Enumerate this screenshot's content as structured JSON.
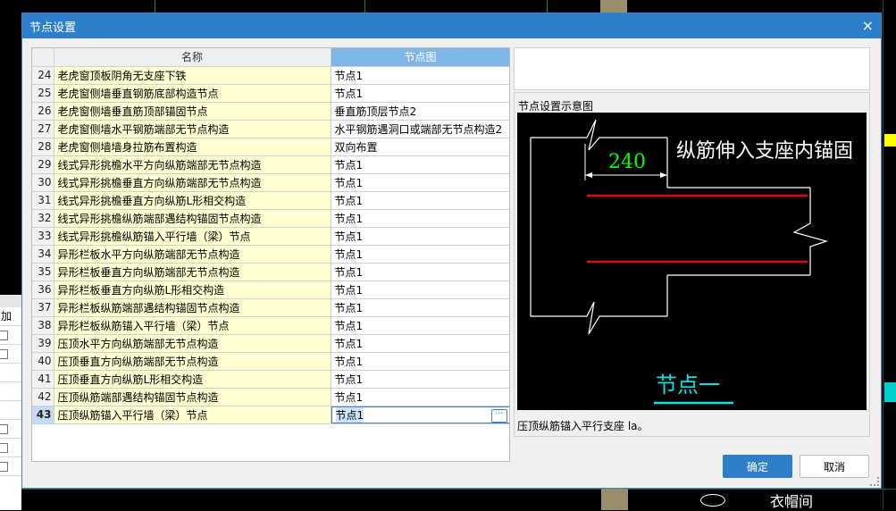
{
  "dialog": {
    "title": "节点设置",
    "close_glyph": "×",
    "ok_label": "确定",
    "cancel_label": "取消"
  },
  "grid": {
    "headers": [
      "",
      "名称",
      "节点图"
    ],
    "rows": [
      {
        "num": "24",
        "name": "老虎窗顶板阴角无支座下铁",
        "value": "节点1"
      },
      {
        "num": "25",
        "name": "老虎窗侧墙垂直钢筋底部构造节点",
        "value": "节点1"
      },
      {
        "num": "26",
        "name": "老虎窗侧墙垂直筋顶部锚固节点",
        "value": "垂直筋顶层节点2"
      },
      {
        "num": "27",
        "name": "老虎窗侧墙水平钢筋端部无节点构造",
        "value": "水平钢筋遇洞口或端部无节点构造2"
      },
      {
        "num": "28",
        "name": "老虎窗侧墙墙身拉筋布置构造",
        "value": "双向布置"
      },
      {
        "num": "29",
        "name": "线式异形挑檐水平方向纵筋端部无节点构造",
        "value": "节点1"
      },
      {
        "num": "30",
        "name": "线式异形挑檐垂直方向纵筋端部无节点构造",
        "value": "节点1"
      },
      {
        "num": "31",
        "name": "线式异形挑檐垂直方向纵筋L形相交构造",
        "value": "节点1"
      },
      {
        "num": "32",
        "name": "线式异形挑檐纵筋端部遇结构锚固节点构造",
        "value": "节点1"
      },
      {
        "num": "33",
        "name": "线式异形挑檐纵筋锚入平行墙（梁）节点",
        "value": "节点1"
      },
      {
        "num": "34",
        "name": "异形栏板水平方向纵筋端部无节点构造",
        "value": "节点1"
      },
      {
        "num": "35",
        "name": "异形栏板垂直方向纵筋端部无节点构造",
        "value": "节点1"
      },
      {
        "num": "36",
        "name": "异形栏板垂直方向纵筋L形相交构造",
        "value": "节点1"
      },
      {
        "num": "37",
        "name": "异形栏板纵筋端部遇结构锚固节点构造",
        "value": "节点1"
      },
      {
        "num": "38",
        "name": "异形栏板纵筋锚入平行墙（梁）节点",
        "value": "节点1"
      },
      {
        "num": "39",
        "name": "压顶水平方向纵筋端部无节点构造",
        "value": "节点1"
      },
      {
        "num": "40",
        "name": "压顶垂直方向纵筋端部无节点构造",
        "value": "节点1"
      },
      {
        "num": "41",
        "name": "压顶垂直方向纵筋L形相交构造",
        "value": "节点1"
      },
      {
        "num": "42",
        "name": "压顶纵筋端部遇结构锚固节点构造",
        "value": "节点1"
      },
      {
        "num": "43",
        "name": "压顶纵筋锚入平行墙（梁）节点",
        "value": "节点1",
        "active": true
      }
    ],
    "edit_button_glyph": "···"
  },
  "preview": {
    "caption": "节点设置示意图",
    "dimension": "240",
    "annotation": "纵筋伸入支座内锚固",
    "node_label": "节点一",
    "description": "压顶纵筋锚入平行支座 la。"
  },
  "background": {
    "add_label": "加",
    "cad_text": "衣帽间"
  },
  "colors": {
    "titlebar": "#2d7fc9",
    "selected_header": "#7fb5e8",
    "name_cell": "#ffffd2",
    "rebar": "#e01010",
    "dimension_text": "#00ff00",
    "node_label": "#00e5e5"
  }
}
